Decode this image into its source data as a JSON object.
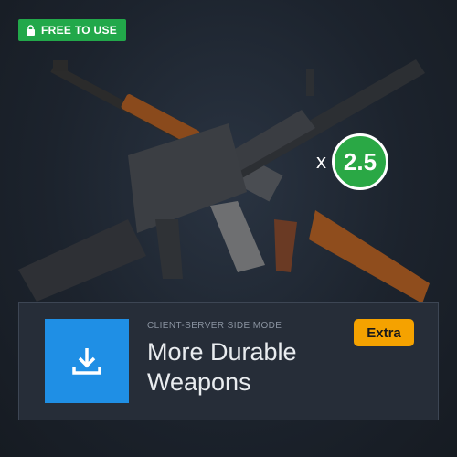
{
  "badge": {
    "label": "FREE TO USE",
    "icon": "lock-icon",
    "color": "#22a84a"
  },
  "multiplier": {
    "prefix": "x",
    "value": "2.5",
    "color": "#2aa845"
  },
  "card": {
    "subtitle": "CLIENT-SERVER SIDE MODE",
    "title": "More Durable Weapons",
    "tag": "Extra",
    "tag_color": "#f5a200",
    "icon": "download-icon",
    "icon_bg": "#1f8fe5"
  },
  "artwork": {
    "subject": "crossed-rifles-image"
  }
}
